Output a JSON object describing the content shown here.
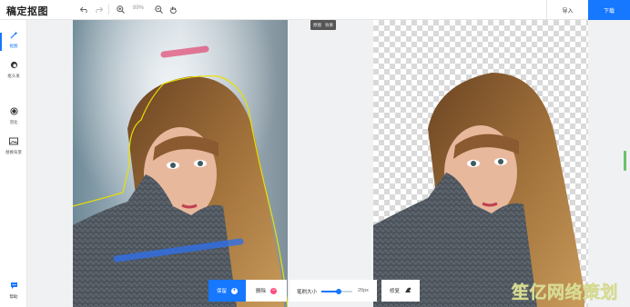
{
  "app": {
    "logo_text": "稿定抠图"
  },
  "toolbar": {
    "undo_icon": "undo-icon",
    "redo_icon": "redo-icon",
    "zoom_in_icon": "zoom-in-icon",
    "zoom_value": "89%",
    "zoom_out_icon": "zoom-out-icon",
    "hand_icon": "hand-icon",
    "import_label": "导入",
    "download_label": "下载"
  },
  "sidebar": {
    "items": [
      {
        "label": "抠图",
        "icon": "magic-wand-icon",
        "active": true
      },
      {
        "label": "抠头发",
        "icon": "hair-icon",
        "active": false
      },
      {
        "label": "羽化",
        "icon": "feather-icon",
        "active": false
      },
      {
        "label": "替换背景",
        "icon": "image-icon",
        "active": false
      }
    ],
    "help": {
      "label": "帮助",
      "icon": "chat-icon"
    }
  },
  "compare": {
    "original_label": "原图",
    "result_label": "效果"
  },
  "bottom_toolbar": {
    "keep_label": "保留",
    "erase_label": "删除",
    "brush_size_label": "笔刷大小",
    "brush_size_value": "20px",
    "brush_size_fraction": 0.55,
    "restore_label": "修复"
  },
  "colors": {
    "accent": "#1677ff",
    "keep_stroke": "#2f6fe8",
    "erase_stroke": "#e0507a",
    "selection_outline": "#e8e000"
  },
  "watermark": "笙亿网络策划"
}
